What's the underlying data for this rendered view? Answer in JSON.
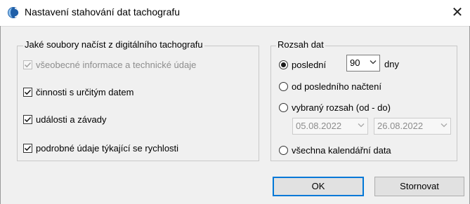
{
  "window": {
    "title": "Nastavení stahování dat tachografu",
    "app_icon": "tachograph-app-icon",
    "close_glyph": "✕"
  },
  "files_group": {
    "title": "Jaké soubory načíst z digitálního tachografu",
    "items": [
      {
        "label": "všeobecné informace a technické údaje",
        "checked": true,
        "disabled": true
      },
      {
        "label": "činnosti s určitým datem",
        "checked": true,
        "disabled": false
      },
      {
        "label": "události a závady",
        "checked": true,
        "disabled": false
      },
      {
        "label": "podrobné údaje týkající se rychlosti",
        "checked": true,
        "disabled": false
      }
    ]
  },
  "range_group": {
    "title": "Rozsah dat",
    "last": {
      "label": "poslední",
      "selected": true,
      "days_value": "90",
      "days_unit": "dny"
    },
    "since_last": {
      "label": "od posledního načtení",
      "selected": false
    },
    "custom": {
      "label": "vybraný rozsah (od - do)",
      "selected": false,
      "from": "05.08.2022",
      "to": "26.08.2022"
    },
    "all": {
      "label": "všechna kalendářní data",
      "selected": false
    }
  },
  "buttons": {
    "ok": "OK",
    "cancel": "Stornovat"
  },
  "colors": {
    "accent": "#0078d7",
    "dialog_bg": "#f0f0f0"
  }
}
